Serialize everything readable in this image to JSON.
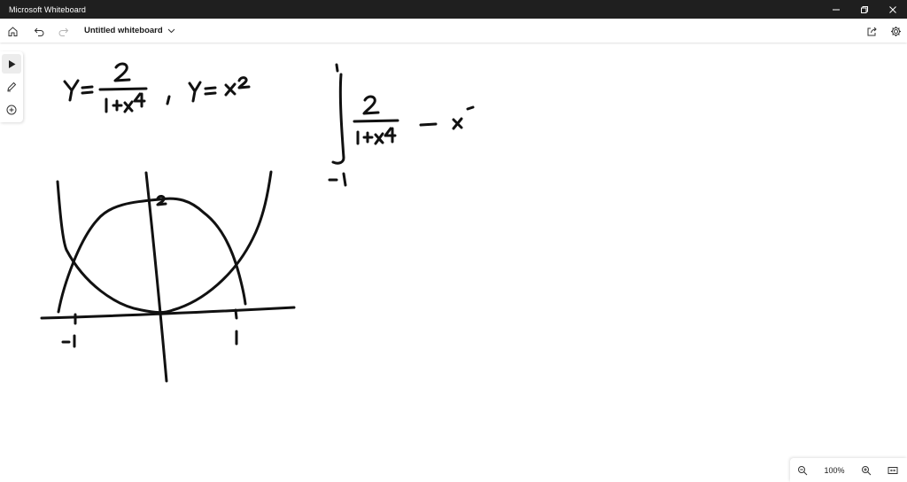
{
  "window": {
    "title": "Microsoft Whiteboard"
  },
  "toolbar": {
    "board_title": "Untitled whiteboard"
  },
  "zoom": {
    "level": "100%"
  },
  "colors": {
    "titlebar_bg": "#1f1f1f",
    "ink": "#111111",
    "canvas_bg": "#ffffff"
  },
  "icons": {
    "home": "home-icon",
    "undo": "undo-icon",
    "redo": "redo-icon",
    "share": "share-icon",
    "settings": "gear-icon",
    "select": "pointer-icon",
    "pen": "pen-icon",
    "add": "plus-circle-icon",
    "zoom_out": "zoom-out-icon",
    "zoom_in": "zoom-in-icon",
    "fit": "fit-screen-icon",
    "minimize": "minimize-icon",
    "restore": "restore-icon",
    "close": "close-icon"
  }
}
